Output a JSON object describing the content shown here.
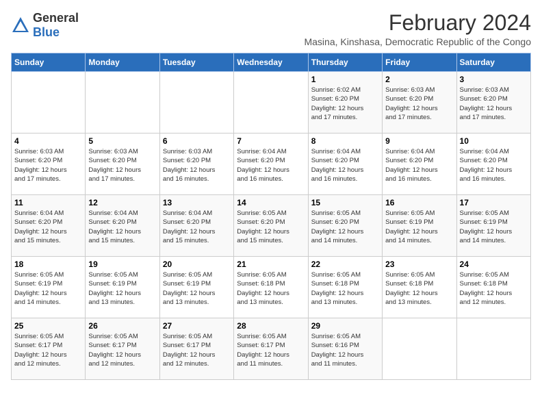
{
  "logo": {
    "text_general": "General",
    "text_blue": "Blue"
  },
  "title": "February 2024",
  "subtitle": "Masina, Kinshasa, Democratic Republic of the Congo",
  "headers": [
    "Sunday",
    "Monday",
    "Tuesday",
    "Wednesday",
    "Thursday",
    "Friday",
    "Saturday"
  ],
  "weeks": [
    [
      {
        "num": "",
        "info": ""
      },
      {
        "num": "",
        "info": ""
      },
      {
        "num": "",
        "info": ""
      },
      {
        "num": "",
        "info": ""
      },
      {
        "num": "1",
        "info": "Sunrise: 6:02 AM\nSunset: 6:20 PM\nDaylight: 12 hours\nand 17 minutes."
      },
      {
        "num": "2",
        "info": "Sunrise: 6:03 AM\nSunset: 6:20 PM\nDaylight: 12 hours\nand 17 minutes."
      },
      {
        "num": "3",
        "info": "Sunrise: 6:03 AM\nSunset: 6:20 PM\nDaylight: 12 hours\nand 17 minutes."
      }
    ],
    [
      {
        "num": "4",
        "info": "Sunrise: 6:03 AM\nSunset: 6:20 PM\nDaylight: 12 hours\nand 17 minutes."
      },
      {
        "num": "5",
        "info": "Sunrise: 6:03 AM\nSunset: 6:20 PM\nDaylight: 12 hours\nand 17 minutes."
      },
      {
        "num": "6",
        "info": "Sunrise: 6:03 AM\nSunset: 6:20 PM\nDaylight: 12 hours\nand 16 minutes."
      },
      {
        "num": "7",
        "info": "Sunrise: 6:04 AM\nSunset: 6:20 PM\nDaylight: 12 hours\nand 16 minutes."
      },
      {
        "num": "8",
        "info": "Sunrise: 6:04 AM\nSunset: 6:20 PM\nDaylight: 12 hours\nand 16 minutes."
      },
      {
        "num": "9",
        "info": "Sunrise: 6:04 AM\nSunset: 6:20 PM\nDaylight: 12 hours\nand 16 minutes."
      },
      {
        "num": "10",
        "info": "Sunrise: 6:04 AM\nSunset: 6:20 PM\nDaylight: 12 hours\nand 16 minutes."
      }
    ],
    [
      {
        "num": "11",
        "info": "Sunrise: 6:04 AM\nSunset: 6:20 PM\nDaylight: 12 hours\nand 15 minutes."
      },
      {
        "num": "12",
        "info": "Sunrise: 6:04 AM\nSunset: 6:20 PM\nDaylight: 12 hours\nand 15 minutes."
      },
      {
        "num": "13",
        "info": "Sunrise: 6:04 AM\nSunset: 6:20 PM\nDaylight: 12 hours\nand 15 minutes."
      },
      {
        "num": "14",
        "info": "Sunrise: 6:05 AM\nSunset: 6:20 PM\nDaylight: 12 hours\nand 15 minutes."
      },
      {
        "num": "15",
        "info": "Sunrise: 6:05 AM\nSunset: 6:20 PM\nDaylight: 12 hours\nand 14 minutes."
      },
      {
        "num": "16",
        "info": "Sunrise: 6:05 AM\nSunset: 6:19 PM\nDaylight: 12 hours\nand 14 minutes."
      },
      {
        "num": "17",
        "info": "Sunrise: 6:05 AM\nSunset: 6:19 PM\nDaylight: 12 hours\nand 14 minutes."
      }
    ],
    [
      {
        "num": "18",
        "info": "Sunrise: 6:05 AM\nSunset: 6:19 PM\nDaylight: 12 hours\nand 14 minutes."
      },
      {
        "num": "19",
        "info": "Sunrise: 6:05 AM\nSunset: 6:19 PM\nDaylight: 12 hours\nand 13 minutes."
      },
      {
        "num": "20",
        "info": "Sunrise: 6:05 AM\nSunset: 6:19 PM\nDaylight: 12 hours\nand 13 minutes."
      },
      {
        "num": "21",
        "info": "Sunrise: 6:05 AM\nSunset: 6:18 PM\nDaylight: 12 hours\nand 13 minutes."
      },
      {
        "num": "22",
        "info": "Sunrise: 6:05 AM\nSunset: 6:18 PM\nDaylight: 12 hours\nand 13 minutes."
      },
      {
        "num": "23",
        "info": "Sunrise: 6:05 AM\nSunset: 6:18 PM\nDaylight: 12 hours\nand 13 minutes."
      },
      {
        "num": "24",
        "info": "Sunrise: 6:05 AM\nSunset: 6:18 PM\nDaylight: 12 hours\nand 12 minutes."
      }
    ],
    [
      {
        "num": "25",
        "info": "Sunrise: 6:05 AM\nSunset: 6:17 PM\nDaylight: 12 hours\nand 12 minutes."
      },
      {
        "num": "26",
        "info": "Sunrise: 6:05 AM\nSunset: 6:17 PM\nDaylight: 12 hours\nand 12 minutes."
      },
      {
        "num": "27",
        "info": "Sunrise: 6:05 AM\nSunset: 6:17 PM\nDaylight: 12 hours\nand 12 minutes."
      },
      {
        "num": "28",
        "info": "Sunrise: 6:05 AM\nSunset: 6:17 PM\nDaylight: 12 hours\nand 11 minutes."
      },
      {
        "num": "29",
        "info": "Sunrise: 6:05 AM\nSunset: 6:16 PM\nDaylight: 12 hours\nand 11 minutes."
      },
      {
        "num": "",
        "info": ""
      },
      {
        "num": "",
        "info": ""
      }
    ]
  ]
}
